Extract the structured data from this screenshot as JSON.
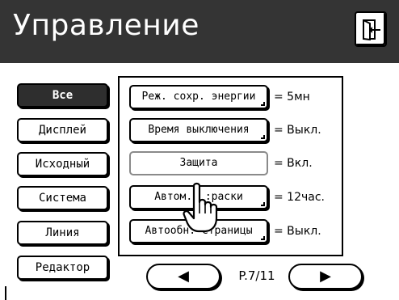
{
  "title": "Управление",
  "icons": {
    "exit": "exit-door-icon",
    "hand": "hand-pointer-icon",
    "prev": "triangle-left-icon",
    "next": "triangle-right-icon"
  },
  "colors": {
    "titlebar": "#343434",
    "active_tab": "#2e2e2e"
  },
  "sidebar": {
    "items": [
      {
        "label": "Все",
        "active": true
      },
      {
        "label": "Дисплей",
        "active": false
      },
      {
        "label": "Исходный",
        "active": false
      },
      {
        "label": "Система",
        "active": false
      },
      {
        "label": "Линия",
        "active": false
      },
      {
        "label": "Редактор",
        "active": false
      }
    ]
  },
  "settings": [
    {
      "label": "Реж. сохр. энергии",
      "value": "= 5мн"
    },
    {
      "label": "Время выключения",
      "value": "= Выкл."
    },
    {
      "label": "Защита",
      "value": "= Вкл.",
      "pressed": true
    },
    {
      "label": "Автом.г          :раски",
      "value": "= 12час."
    },
    {
      "label": "Автообн. Страницы",
      "value": "= Выкл."
    }
  ],
  "pager": {
    "prev_symbol": "◀",
    "next_symbol": "▶",
    "page": "P.7/11"
  }
}
